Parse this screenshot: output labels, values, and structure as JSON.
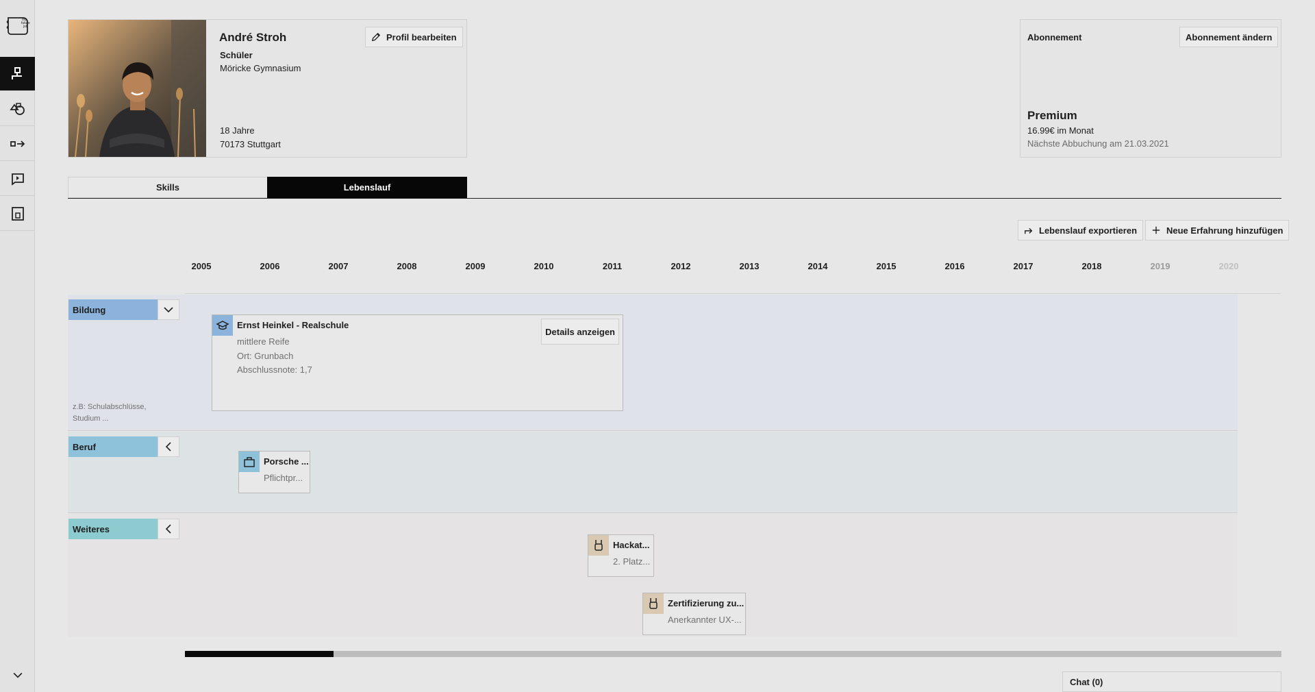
{
  "sidebar": {
    "logo": "notebook-logo-icon",
    "items": [
      {
        "icon": "profile-icon",
        "active": true
      },
      {
        "icon": "shapes-icon",
        "active": false
      },
      {
        "icon": "transfer-icon",
        "active": false
      },
      {
        "icon": "chat-bubble-icon",
        "active": false
      },
      {
        "icon": "document-icon",
        "active": false
      }
    ],
    "bottom_icon": "chevron-down-icon"
  },
  "profile": {
    "name": "André Stroh",
    "role": "Schüler",
    "school": "Möricke Gymnasium",
    "age": "18 Jahre",
    "city": "70173 Stuttgart",
    "edit_label": "Profil bearbeiten"
  },
  "subscription": {
    "title": "Abonnement",
    "change_label": "Abonnement ändern",
    "plan": "Premium",
    "price": "16.99€ im Monat",
    "next_charge": "Nächste Abbuchung am 21.03.2021"
  },
  "tabs": [
    {
      "label": "Skills",
      "active": false
    },
    {
      "label": "Lebenslauf",
      "active": true
    }
  ],
  "toolbar": {
    "export_label": "Lebenslauf exportieren",
    "add_label": "Neue Erfahrung hinzufügen"
  },
  "timeline": {
    "years": [
      "2005",
      "2006",
      "2007",
      "2008",
      "2009",
      "2010",
      "2011",
      "2012",
      "2013",
      "2014",
      "2015",
      "2016",
      "2017",
      "2018",
      "2019",
      "2020"
    ],
    "categories": [
      {
        "label": "Bildung",
        "color": "#8cb3dc",
        "expanded": true,
        "hint": "z.B: Schulabschlüsse, Studium ..."
      },
      {
        "label": "Beruf",
        "color": "#8ec2da",
        "expanded": false
      },
      {
        "label": "Weiteres",
        "color": "#8ccbcf",
        "expanded": false
      }
    ],
    "entries": {
      "education": {
        "title": "Ernst Heinkel - Realschule",
        "degree": "mittlere Reife",
        "location": "Ort: Grunbach",
        "grade": "Abschlussnote: 1,7",
        "details_label": "Details anzeigen",
        "icon": "graduation-cap-icon",
        "icon_color": "#8cb3dc"
      },
      "job": {
        "title": "Porsche ...",
        "subtitle": "Pflichtpr...",
        "icon": "briefcase-icon",
        "icon_color": "#8ec2da"
      },
      "hackathon": {
        "title": "Hackat...",
        "subtitle": "2. Platz...",
        "icon": "medal-icon",
        "icon_color": "#d9c9b3"
      },
      "certificate": {
        "title": "Zertifizierung zu...",
        "subtitle": "Anerkannter UX-...",
        "icon": "medal-icon",
        "icon_color": "#d9c9b3"
      }
    },
    "scroll_position": 0.13
  },
  "chat": {
    "label": "Chat (0)"
  }
}
